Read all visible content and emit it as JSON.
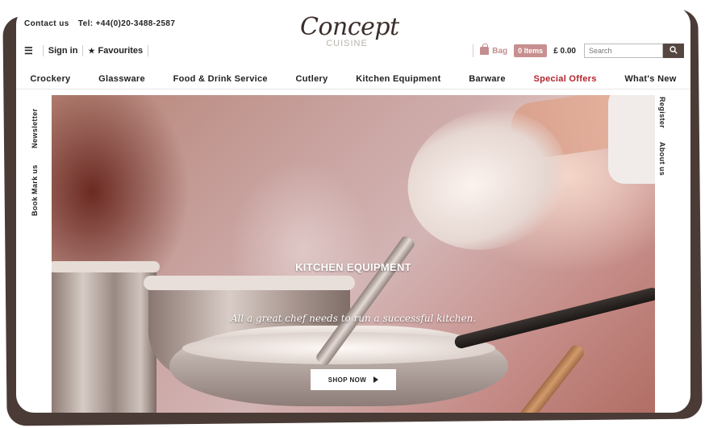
{
  "header": {
    "contact_label": "Contact us",
    "phone": "Tel: +44(0)20-3488-2587",
    "logo_script": "Concept",
    "logo_sub": "CUISINE"
  },
  "account": {
    "sign_in": "Sign in",
    "favourites": "Favourites"
  },
  "shop": {
    "bag_label": "Bag",
    "items_badge": "0 Items",
    "total": "£ 0.00",
    "search_placeholder": "Search"
  },
  "nav": {
    "items": [
      "Crockery",
      "Glassware",
      "Food & Drink Service",
      "Cutlery",
      "Kitchen Equipment",
      "Barware",
      "Special Offers",
      "What's New"
    ]
  },
  "side_left": {
    "newsletter": "Newsletter",
    "bookmark": "Book Mark us"
  },
  "side_right": {
    "register": "Register",
    "about": "About us"
  },
  "hero": {
    "title": "KITCHEN EQUIPMENT",
    "subtitle": "All a great chef needs to run a successful kitchen.",
    "cta": "SHOP NOW"
  },
  "colors": {
    "accent": "#c78f8f",
    "special_offers": "#b3232b",
    "search_button": "#554740",
    "frame": "#4a3b36"
  }
}
